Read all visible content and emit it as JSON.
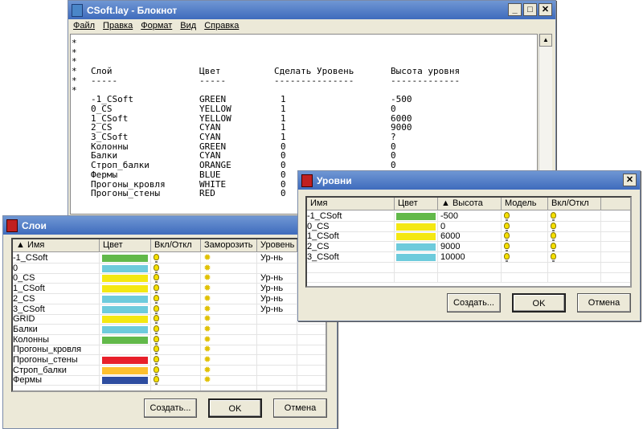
{
  "notepad": {
    "title": "CSoft.lay - Блокнот",
    "menu": [
      "Файл",
      "Правка",
      "Формат",
      "Вид",
      "Справка"
    ],
    "header": {
      "star": "*",
      "c1": "Слой",
      "c2": "Цвет",
      "c3": "Сделать Уровень",
      "c4": "Высота уровня",
      "d1": "-----",
      "d2": "-----",
      "d3": "---------------",
      "d4": "-------------"
    },
    "rows": [
      [
        "-1_CSoft",
        "GREEN",
        "1",
        "-500"
      ],
      [
        "0_CS",
        "YELLOW",
        "1",
        "0"
      ],
      [
        "1_CSoft",
        "YELLOW",
        "1",
        "6000"
      ],
      [
        "2_CS",
        "CYAN",
        "1",
        "9000"
      ],
      [
        "3_CSoft",
        "CYAN",
        "1",
        "?"
      ],
      [
        "Колонны",
        "GREEN",
        "0",
        "0"
      ],
      [
        "Балки",
        "CYAN",
        "0",
        "0"
      ],
      [
        "Строп_балки",
        "ORANGE",
        "0",
        "0"
      ],
      [
        "Фермы",
        "BLUE",
        "0",
        "0"
      ],
      [
        "Прогоны_кровля",
        "WHITE",
        "0",
        "0"
      ],
      [
        "Прогоны_стены",
        "RED",
        "0",
        "0"
      ]
    ]
  },
  "layers": {
    "title": "Слои",
    "columns": [
      "▲ Имя",
      "Цвет",
      "Вкл/Откл",
      "Заморозить",
      "Уровень"
    ],
    "rows": [
      {
        "name": "-1_CSoft",
        "color": "#62b94a",
        "level": "Ур-нь"
      },
      {
        "name": "0",
        "color": "#6ecbdc",
        "level": ""
      },
      {
        "name": "0_CS",
        "color": "#f4e812",
        "level": "Ур-нь"
      },
      {
        "name": "1_CSoft",
        "color": "#f4e812",
        "level": "Ур-нь"
      },
      {
        "name": "2_CS",
        "color": "#6ecbdc",
        "level": "Ур-нь"
      },
      {
        "name": "3_CSoft",
        "color": "#6ecbdc",
        "level": "Ур-нь"
      },
      {
        "name": "GRID",
        "color": "#f4e812",
        "level": ""
      },
      {
        "name": "Балки",
        "color": "#6ecbdc",
        "level": ""
      },
      {
        "name": "Колонны",
        "color": "#62b94a",
        "level": ""
      },
      {
        "name": "Прогоны_кровля",
        "color": "#ffffff",
        "level": ""
      },
      {
        "name": "Прогоны_стены",
        "color": "#e8202a",
        "level": ""
      },
      {
        "name": "Строп_балки",
        "color": "#fdc02e",
        "level": ""
      },
      {
        "name": "Фермы",
        "color": "#2e4da0",
        "level": ""
      }
    ],
    "buttons": {
      "create": "Создать...",
      "ok": "OK",
      "cancel": "Отмена"
    }
  },
  "levels": {
    "title": "Уровни",
    "close": "✕",
    "columns": [
      "Имя",
      "Цвет",
      "▲ Высота",
      "Модель",
      "Вкл/Откл"
    ],
    "rows": [
      {
        "name": "-1_CSoft",
        "color": "#62b94a",
        "height": "-500"
      },
      {
        "name": "0_CS",
        "color": "#f4e812",
        "height": "0"
      },
      {
        "name": "1_CSoft",
        "color": "#f4e812",
        "height": "6000"
      },
      {
        "name": "2_CS",
        "color": "#6ecbdc",
        "height": "9000"
      },
      {
        "name": "3_CSoft",
        "color": "#6ecbdc",
        "height": "10000"
      }
    ],
    "buttons": {
      "create": "Создать...",
      "ok": "OK",
      "cancel": "Отмена"
    }
  }
}
